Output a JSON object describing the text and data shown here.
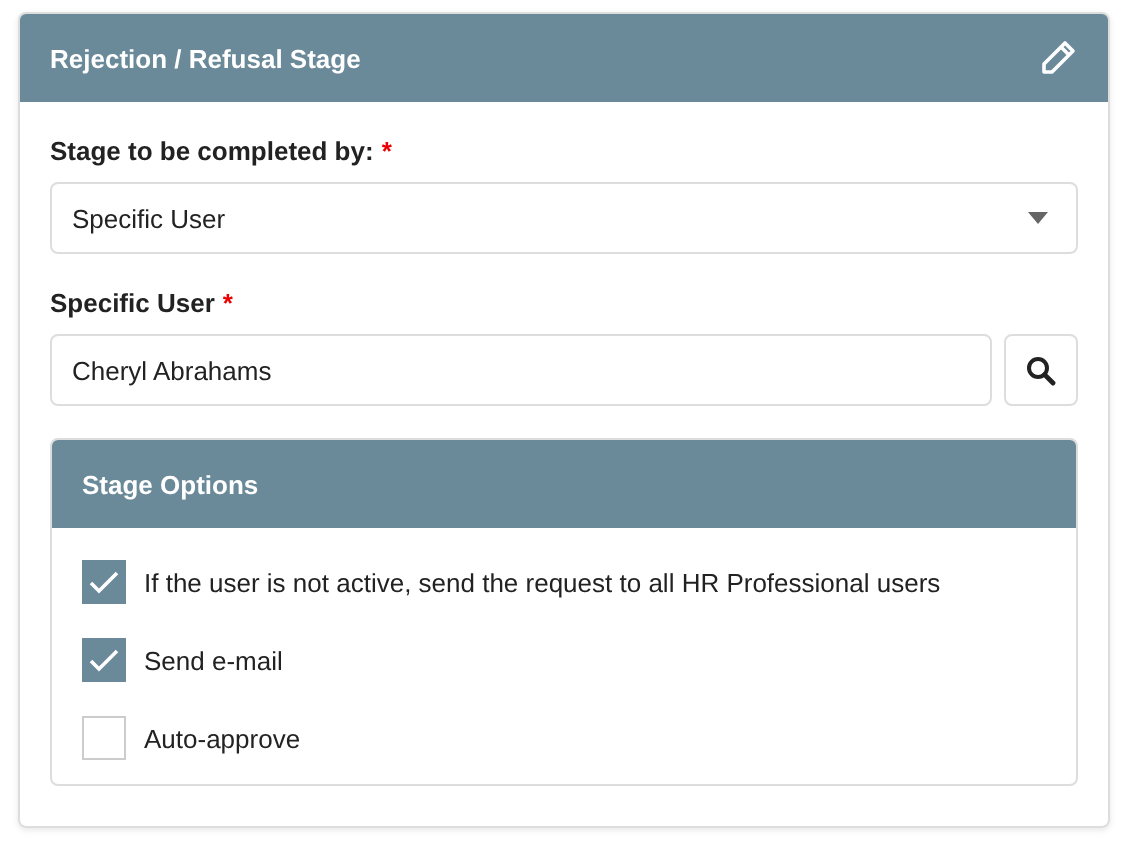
{
  "panel": {
    "title": "Rejection / Refusal Stage"
  },
  "fields": [
    {
      "kind": "select",
      "label": "Stage to be completed by:",
      "required_mark": "*",
      "value": "Specific User"
    },
    {
      "kind": "lookup",
      "label": "Specific User",
      "required_mark": "*",
      "value": "Cheryl Abrahams"
    }
  ],
  "options": {
    "title": "Stage Options",
    "items": [
      {
        "label": "If the user is not active, send the request to all HR Professional users",
        "checked": true
      },
      {
        "label": "Send e-mail",
        "checked": true
      },
      {
        "label": "Auto-approve",
        "checked": false
      }
    ]
  }
}
